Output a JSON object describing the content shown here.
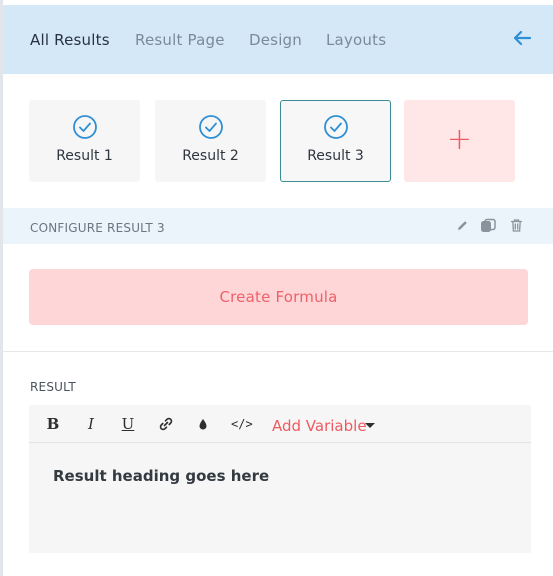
{
  "tabs": [
    {
      "label": "All Results",
      "active": true
    },
    {
      "label": "Result Page",
      "active": false
    },
    {
      "label": "Design",
      "active": false
    },
    {
      "label": "Layouts",
      "active": false
    }
  ],
  "back_icon": "arrow-left-icon",
  "results": [
    {
      "label": "Result 1",
      "selected": false,
      "icon": "check-circle-icon"
    },
    {
      "label": "Result 2",
      "selected": false,
      "icon": "check-circle-icon"
    },
    {
      "label": "Result 3",
      "selected": true,
      "icon": "check-circle-icon"
    }
  ],
  "add_result": {
    "symbol": "+",
    "icon": "plus-icon"
  },
  "configure": {
    "title": "CONFIGURE RESULT 3",
    "icons": [
      "pencil-icon",
      "duplicate-icon",
      "trash-icon"
    ]
  },
  "formula_button": "Create Formula",
  "result_section": {
    "label": "RESULT",
    "toolbar": {
      "bold": "B",
      "italic": "I",
      "underline": "U",
      "link_icon": "link-icon",
      "color_icon": "droplet-icon",
      "code": "</>",
      "add_variable": "Add Variable"
    },
    "content": "Result heading goes here"
  },
  "colors": {
    "header_bg": "#d4e8f8",
    "accent_blue": "#2e8fd4",
    "accent_red": "#ef5a60",
    "selected_border": "#3a8c94"
  }
}
